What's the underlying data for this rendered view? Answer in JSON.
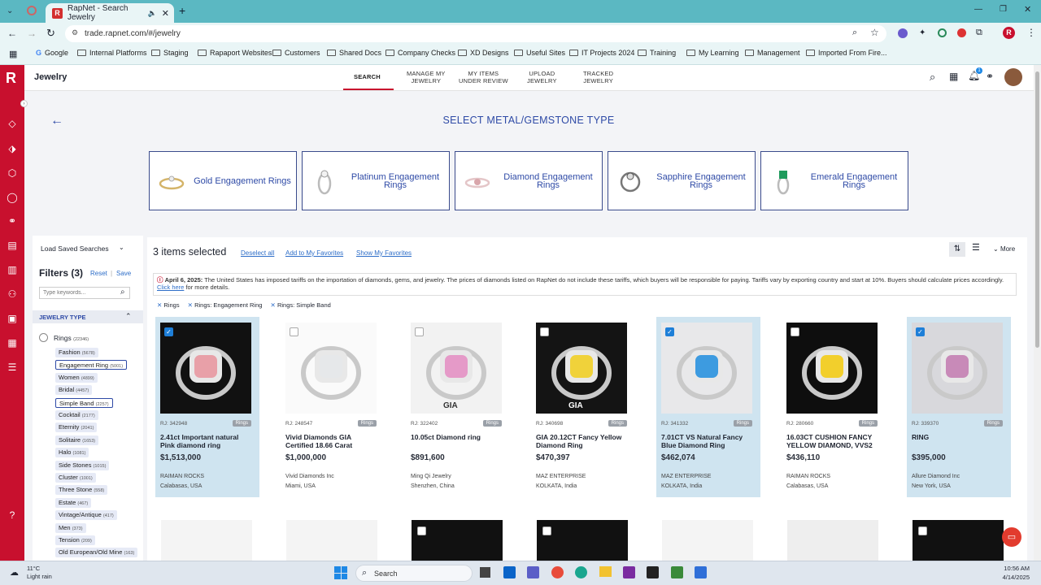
{
  "browser": {
    "tab_title": "RapNet - Search Jewelry",
    "url": "trade.rapnet.com/#/jewelry",
    "bookmarks": [
      "Google",
      "Internal Platforms",
      "Staging",
      "Rapaport Websites",
      "Customers",
      "Shared Docs",
      "Company Checks",
      "XD Designs",
      "Useful Sites",
      "IT Projects 2024",
      "Training",
      "My Learning",
      "Management",
      "Imported From Fire..."
    ]
  },
  "app": {
    "logo": "R",
    "page_title": "Jewelry",
    "nav": [
      {
        "label": "SEARCH",
        "active": true
      },
      {
        "label": "MANAGE MY\nJEWELRY"
      },
      {
        "label": "MY ITEMS\nUNDER REVIEW"
      },
      {
        "label": "UPLOAD\nJEWELRY"
      },
      {
        "label": "TRACKED\nJEWELRY"
      }
    ],
    "notification_count": "1"
  },
  "selector": {
    "heading": "SELECT METAL/GEMSTONE TYPE",
    "cards": [
      "Gold Engagement Rings",
      "Platinum Engagement Rings",
      "Diamond Engagement Rings",
      "Sapphire Engagement Rings",
      "Emerald Engagement Rings"
    ]
  },
  "filters": {
    "load_saved": "Load Saved Searches",
    "title": "Filters (3)",
    "reset": "Reset",
    "save": "Save",
    "keywords_placeholder": "Type keywords...",
    "section": "JEWELRY TYPE",
    "rings_label": "Rings",
    "rings_count": "(22346)",
    "items": [
      {
        "label": "Fashion",
        "count": "(5678)"
      },
      {
        "label": "Engagement Ring",
        "count": "(5001)",
        "selected": true
      },
      {
        "label": "Women",
        "count": "(4899)"
      },
      {
        "label": "Bridal",
        "count": "(4457)"
      },
      {
        "label": "Simple Band",
        "count": "(2257)",
        "selected": true
      },
      {
        "label": "Cocktail",
        "count": "(2177)"
      },
      {
        "label": "Eternity",
        "count": "(2041)"
      },
      {
        "label": "Solitaire",
        "count": "(1653)"
      },
      {
        "label": "Halo",
        "count": "(1081)"
      },
      {
        "label": "Side Stones",
        "count": "(1015)"
      },
      {
        "label": "Cluster",
        "count": "(1001)"
      },
      {
        "label": "Three Stone",
        "count": "(558)"
      },
      {
        "label": "Estate",
        "count": "(467)"
      },
      {
        "label": "Vintage/Antique",
        "count": "(417)"
      },
      {
        "label": "Men",
        "count": "(373)"
      },
      {
        "label": "Tension",
        "count": "(209)"
      },
      {
        "label": "Old European/Old Mine",
        "count": "(163)"
      }
    ]
  },
  "results": {
    "selected_text": "3 items selected",
    "deselect_all": "Deselect all",
    "add_favorites": "Add to My Favorites",
    "show_favorites": "Show My Favorites",
    "more": "More",
    "notice_date": "April 6, 2025:",
    "notice_text": "The United States has imposed tariffs on the importation of diamonds, gems, and jewelry. The prices of diamonds listed on RapNet do not include these tariffs, which buyers will be responsible for paying. Tariffs vary by exporting country and start at 10%. Buyers should calculate prices accordingly.",
    "notice_link": "Click here",
    "notice_tail": "for more details.",
    "active_filters": [
      "Rings",
      "Rings: Engagement Ring",
      "Rings: Simple Band"
    ],
    "products": [
      {
        "rj": "RJ: 342948",
        "tag": "Rings",
        "name": "2.41ct Important natural Pink diamond ring",
        "price": "$1,513,000",
        "seller": "RAIMAN ROCKS",
        "location": "Calabasas, USA",
        "selected": true,
        "stone": "#e8a0a8",
        "bg": "#111"
      },
      {
        "rj": "RJ: 248547",
        "tag": "Rings",
        "name": "Vivid Diamonds GIA Certified 18.66 Carat",
        "price": "$1,000,000",
        "seller": "Vivid Diamonds Inc",
        "location": "Miami, USA",
        "selected": false,
        "stone": "#e6e8ea",
        "bg": "#fafafa"
      },
      {
        "rj": "RJ: 322402",
        "tag": "Rings",
        "name": "10.05ct Diamond ring",
        "price": "$891,600",
        "seller": "Ming Qi Jewelry",
        "location": "Shenzhen, China",
        "selected": false,
        "stone": "#e59ac8",
        "bg": "#f2f2f2",
        "caption": "GIA"
      },
      {
        "rj": "RJ: 340698",
        "tag": "Rings",
        "name": "GIA 20.12CT Fancy Yellow Diamond Ring",
        "price": "$470,397",
        "seller": "MAZ ENTERPRISE",
        "location": "KOLKATA, India",
        "selected": false,
        "stone": "#f0d23a",
        "bg": "#141414",
        "caption": "GIA"
      },
      {
        "rj": "RJ: 341332",
        "tag": "Rings",
        "name": "7.01CT VS Natural Fancy Blue Diamond Ring",
        "price": "$462,074",
        "seller": "MAZ ENTERPRISE",
        "location": "KOLKATA, India",
        "selected": true,
        "stone": "#3d9be0",
        "bg": "#e8e8ea"
      },
      {
        "rj": "RJ: 280660",
        "tag": "Rings",
        "name": "16.03CT CUSHION FANCY YELLOW DIAMOND, VVS2",
        "price": "$436,110",
        "seller": "RAIMAN ROCKS",
        "location": "Calabasas, USA",
        "selected": false,
        "stone": "#f2cf2c",
        "bg": "#0e0e0e"
      },
      {
        "rj": "RJ: 339370",
        "tag": "Rings",
        "name": "RING",
        "price": "$395,000",
        "seller": "Allure Diamond Inc",
        "location": "New York, USA",
        "selected": true,
        "stone": "#c88ab8",
        "bg": "#d8d8dc"
      }
    ]
  },
  "taskbar": {
    "weather_temp": "11°C",
    "weather_desc": "Light rain",
    "search": "Search",
    "time": "10:56 AM",
    "date": "4/14/2025"
  },
  "colors": {
    "brand_red": "#c8102e",
    "link_blue": "#2e4aa6",
    "selected_card": "#cfe4f0"
  }
}
